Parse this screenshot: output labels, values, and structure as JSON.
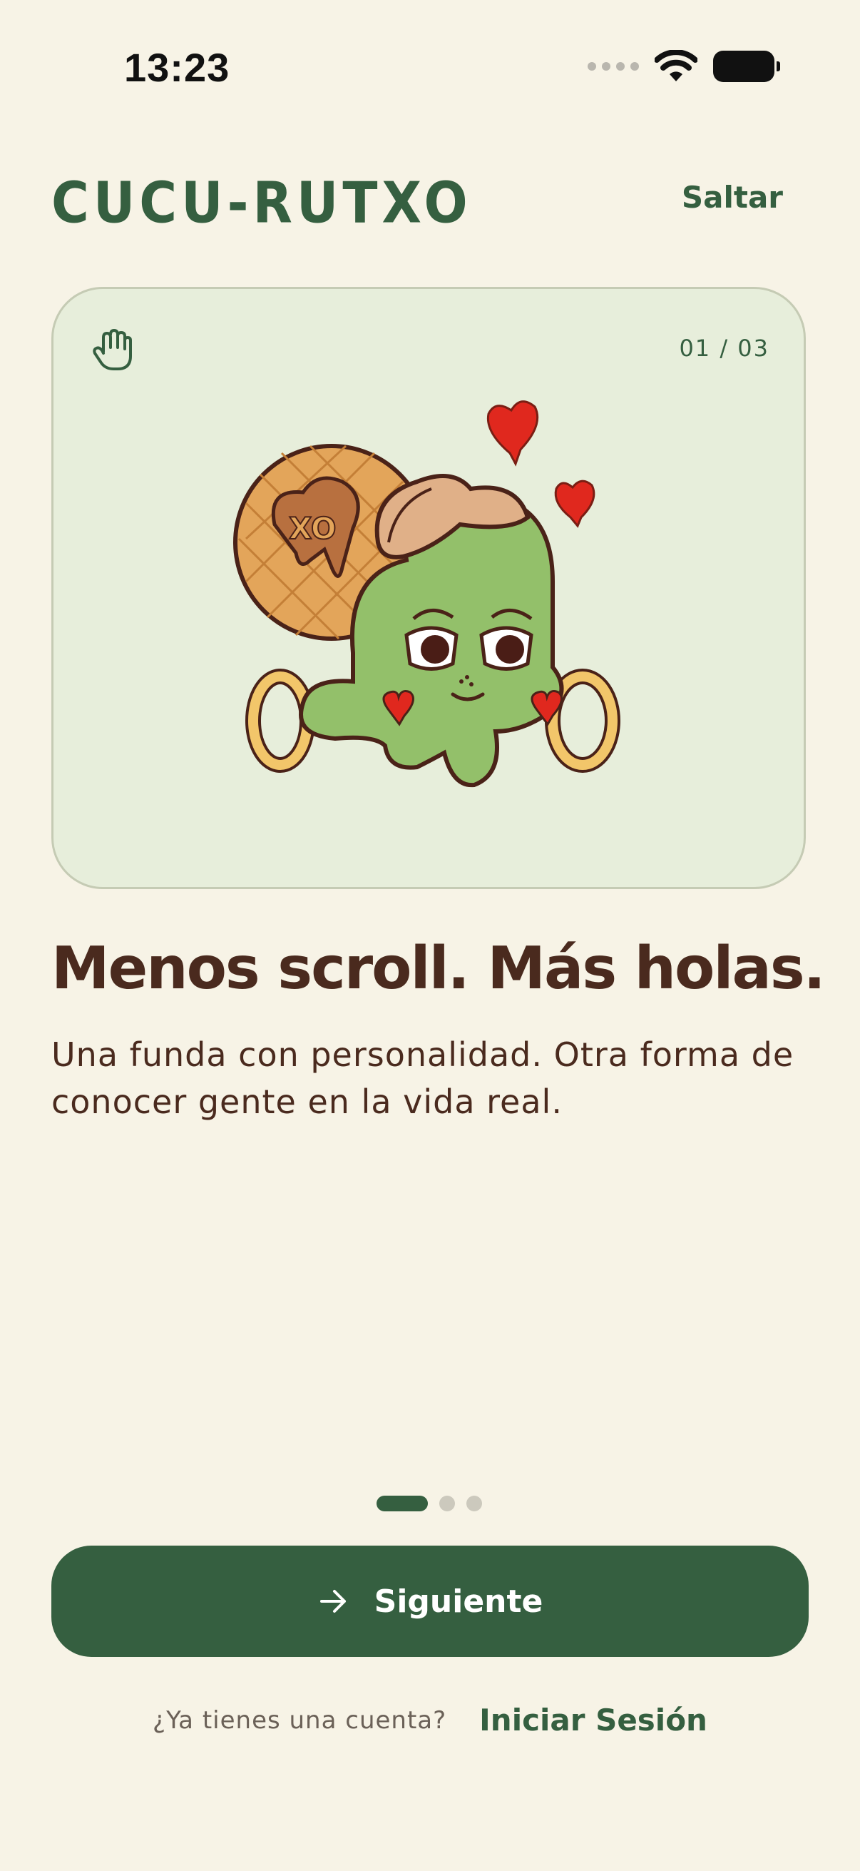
{
  "status_bar": {
    "time": "13:23",
    "icons": [
      "cellular-signal-icon",
      "wifi-icon",
      "battery-icon"
    ]
  },
  "header": {
    "logo": "CUCU-RUTXO",
    "skip_label": "Saltar"
  },
  "slide": {
    "counter": "01 / 03",
    "icon": "hand-wave-icon",
    "illustration": "mascot-illustration",
    "headline": "Menos scroll. Más holas.",
    "subtitle": "Una funda con personalidad. Otra forma de conocer gente en la vida real."
  },
  "pager": {
    "total": 3,
    "active_index": 0
  },
  "actions": {
    "next_label": "Siguiente",
    "next_icon": "arrow-right-icon",
    "login_prompt": "¿Ya tienes una cuenta?",
    "login_link": "Iniciar Sesión"
  },
  "colors": {
    "background": "#f7f3e6",
    "primary_green": "#355f40",
    "card_bg": "#e7eedb",
    "text_brown": "#4a2a1e"
  }
}
